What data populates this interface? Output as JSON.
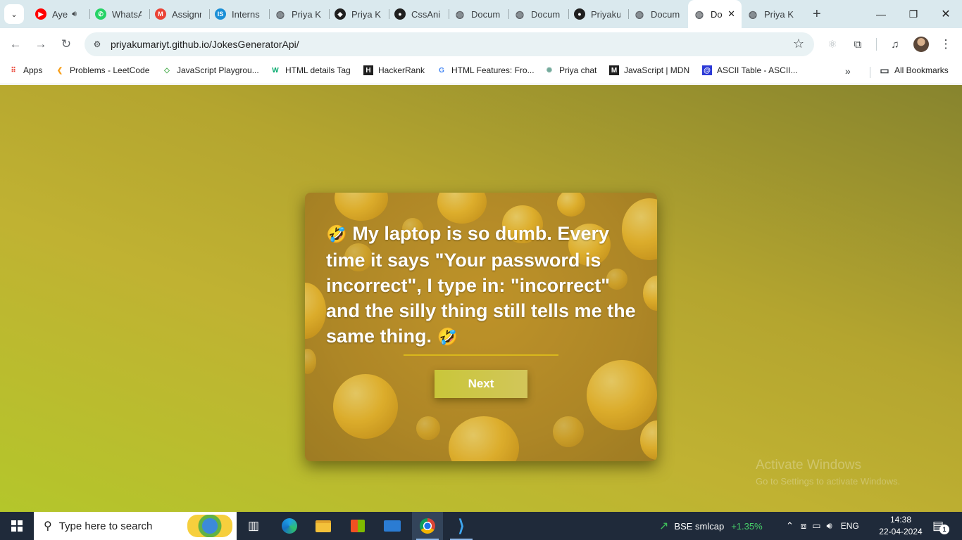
{
  "browser": {
    "tabs": [
      {
        "title": "Aye",
        "icon": "youtube-icon",
        "color": "#ff0000",
        "glyph": "▶",
        "audio": true
      },
      {
        "title": "WhatsApp",
        "icon": "whatsapp-icon",
        "color": "#25d366",
        "glyph": "✆"
      },
      {
        "title": "Assignment",
        "icon": "gmail-icon",
        "color": "#ea4335",
        "glyph": "M"
      },
      {
        "title": "Interns",
        "icon": "internshala-icon",
        "color": "#1a8fd6",
        "glyph": "IS"
      },
      {
        "title": "Priya K",
        "icon": "globe-icon",
        "color": "#5f6368",
        "glyph": "◍"
      },
      {
        "title": "Priya K",
        "icon": "codepen-icon",
        "color": "#1f1f1f",
        "glyph": "◆"
      },
      {
        "title": "CssAni",
        "icon": "github-icon",
        "color": "#1f1f1f",
        "glyph": "●"
      },
      {
        "title": "Docum",
        "icon": "globe-icon",
        "color": "#5f6368",
        "glyph": "◍"
      },
      {
        "title": "Docum",
        "icon": "globe-icon",
        "color": "#5f6368",
        "glyph": "◍"
      },
      {
        "title": "Priyaku",
        "icon": "github-icon",
        "color": "#1f1f1f",
        "glyph": "●"
      },
      {
        "title": "Docum",
        "icon": "globe-icon",
        "color": "#5f6368",
        "glyph": "◍"
      },
      {
        "title": "Do",
        "icon": "globe-icon",
        "color": "#5f6368",
        "glyph": "◍",
        "active": true
      },
      {
        "title": "Priya K",
        "icon": "globe-icon",
        "color": "#5f6368",
        "glyph": "◍"
      }
    ],
    "url": "priyakumariyt.github.io/JokesGeneratorApi/",
    "bookmarks": [
      {
        "label": "Apps",
        "icon": "apps-grid-icon",
        "color": "#ea4335",
        "glyph": "⠿"
      },
      {
        "label": "Problems - LeetCode",
        "icon": "leetcode-icon",
        "color": "#f89f1b",
        "glyph": "❮"
      },
      {
        "label": "JavaScript Playgrou...",
        "icon": "playground-icon",
        "color": "#4caf50",
        "glyph": "◇"
      },
      {
        "label": "HTML details Tag",
        "icon": "w3schools-icon",
        "color": "#04aa6d",
        "glyph": "W"
      },
      {
        "label": "HackerRank",
        "icon": "hackerrank-icon",
        "color": "#1f1f1f",
        "glyph": "H"
      },
      {
        "label": "HTML Features: Fro...",
        "icon": "google-icon",
        "color": "#4285f4",
        "glyph": "G"
      },
      {
        "label": "Priya chat",
        "icon": "chatgpt-icon",
        "color": "#74aa9c",
        "glyph": "✺"
      },
      {
        "label": "JavaScript | MDN",
        "icon": "mdn-icon",
        "color": "#1f1f1f",
        "glyph": "M"
      },
      {
        "label": "ASCII Table - ASCII...",
        "icon": "ascii-icon",
        "color": "#2b39d6",
        "glyph": "@"
      }
    ],
    "all_bookmarks": "All Bookmarks"
  },
  "page": {
    "joke_emoji": "🤣",
    "joke_text": "My laptop is so dumb. Every time it says \"Your password is incorrect\", I type in: \"incorrect\" and the silly thing still tells me the same thing.",
    "next_label": "Next",
    "watermark_title": "Activate Windows",
    "watermark_sub": "Go to Settings to activate Windows."
  },
  "taskbar": {
    "search_placeholder": "Type here to search",
    "stock_name": "BSE smlcap",
    "stock_change": "+1.35%",
    "language": "ENG",
    "time": "14:38",
    "date": "22-04-2024",
    "notification_count": "1"
  }
}
